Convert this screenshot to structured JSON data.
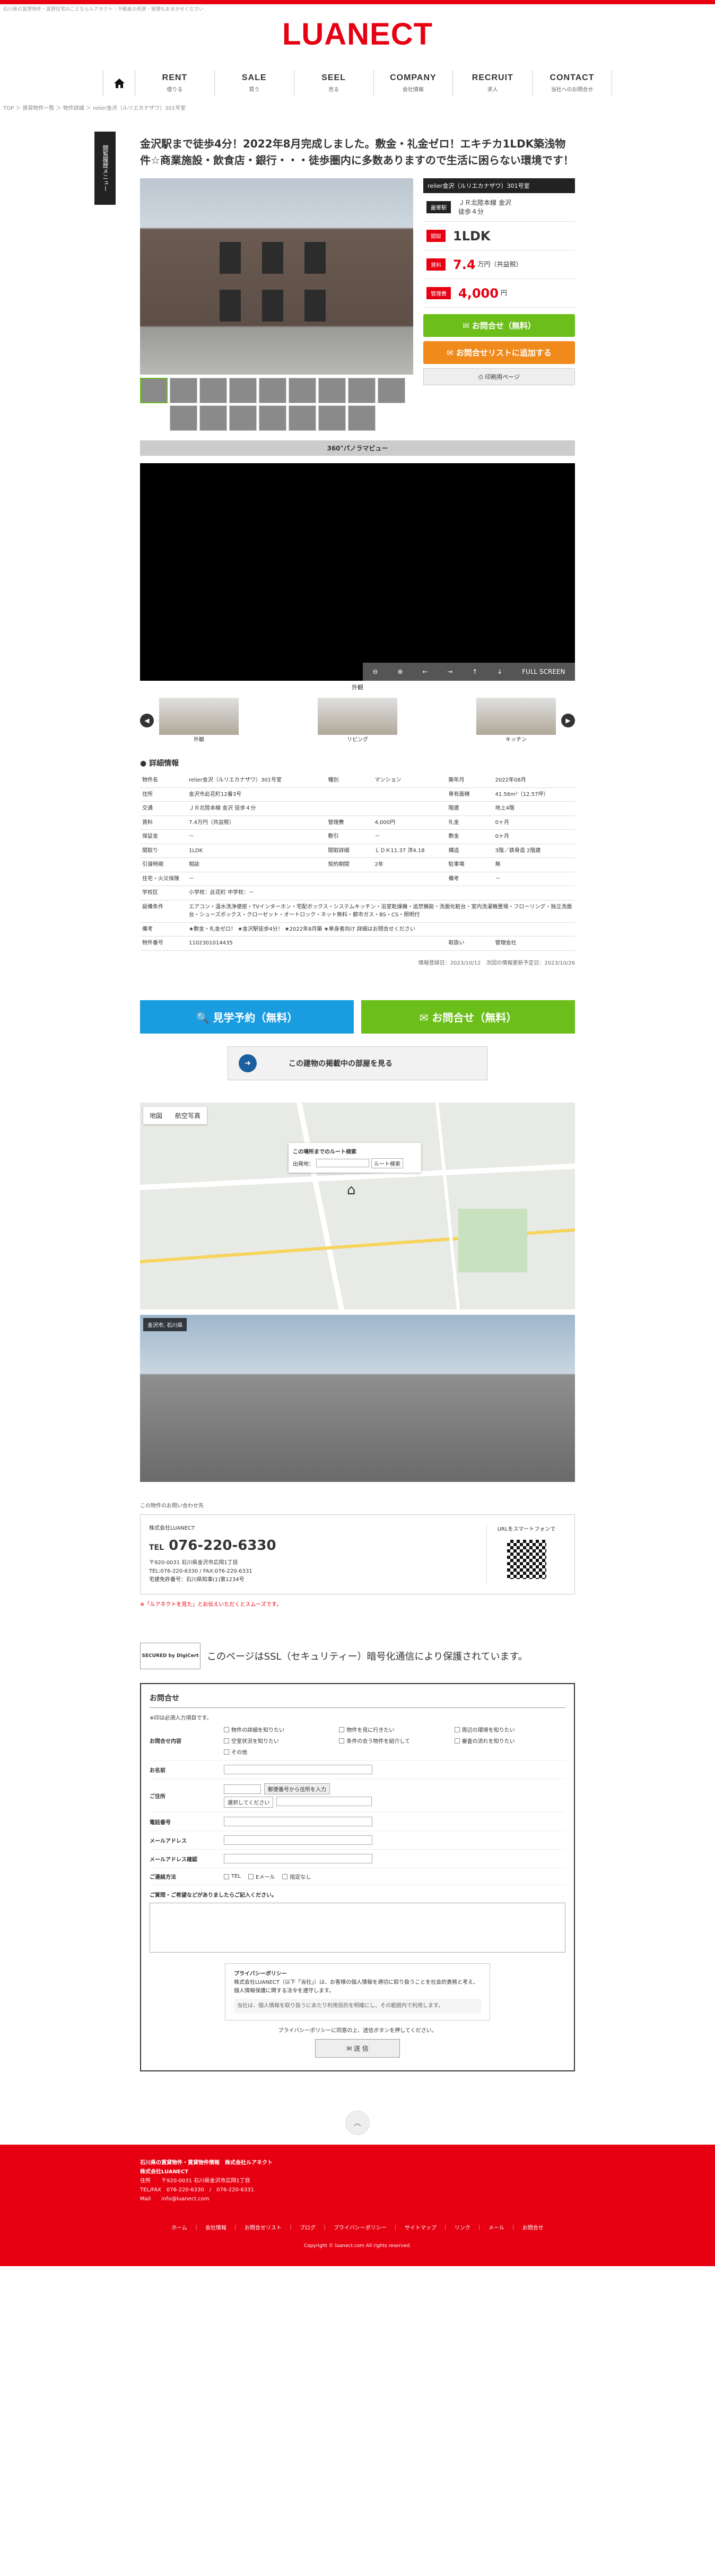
{
  "header": {
    "tagline": "石川県の賃貸物件・賃貸住宅のことならルアネクト｜不動産の売買・管理もおまかせください",
    "logo": "LUANECT",
    "nav": [
      {
        "en": "RENT",
        "ja": "借りる"
      },
      {
        "en": "SALE",
        "ja": "買う"
      },
      {
        "en": "SEEL",
        "ja": "売る"
      },
      {
        "en": "COMPANY",
        "ja": "会社情報"
      },
      {
        "en": "RECRUIT",
        "ja": "求人"
      },
      {
        "en": "CONTACT",
        "ja": "当社へのお問合せ"
      }
    ],
    "breadcrumb": "TOP ＞ 賃貸物件一覧 ＞ 物件詳細 ＞ relier金沢（ルリエカナザワ）301号室"
  },
  "side_tab": "閲覧履歴メニュー",
  "property": {
    "title": "金沢駅まで徒歩4分！2022年8月完成しました。敷金・礼金ゼロ！エキチカ1LDK築浅物件☆商業施設・飲食店・銀行・・・徒歩圏内に多数ありますので生活に困らない環境です！",
    "info_head": "relier金沢（ルリエカナザワ）301号室",
    "station_label": "最寄駅",
    "station_value": "ＪＲ北陸本線 金沢\n徒歩４分",
    "layout_label": "間取",
    "layout_value": "1LDK",
    "rent_label": "賃料",
    "rent_value": "7.4",
    "rent_unit": "万円（共益税）",
    "fee_label": "管理費",
    "fee_value": "4,000",
    "fee_unit": "円",
    "btn_contact": "お問合せ（無料）",
    "btn_list": "お問合せリストに追加する",
    "btn_print": "印刷用ページ"
  },
  "pano": {
    "title": "360°パノラマビュー",
    "caption": "外観",
    "ctrl_full": "FULL SCREEN",
    "strip": [
      "外観",
      "リビング",
      "キッチン"
    ]
  },
  "detail": {
    "heading": "詳細情報",
    "rows": [
      [
        "物件名",
        "relier金沢（ルリエカナザワ）301号室",
        "種別",
        "マンション",
        "築年月",
        "2022年08月"
      ],
      [
        "住所",
        "金沢市此花町12番3号",
        "",
        "",
        "専有面積",
        "41.56m²（12.57坪）"
      ],
      [
        "交通",
        "ＪＲ北陸本線 金沢 徒歩４分",
        "",
        "",
        "階建",
        "地上4階"
      ],
      [
        "賃料",
        "7.4万円（共益税）",
        "管理費",
        "4,000円",
        "礼金",
        "0ヶ月"
      ],
      [
        "保証金",
        "－",
        "敷引",
        "－",
        "敷金",
        "0ヶ月"
      ],
      [
        "間取り",
        "1LDK",
        "間取詳細",
        "ＬＤＫ11.37 洋4.18",
        "構造",
        "3階／鉄骨造 2階建"
      ],
      [
        "引渡時期",
        "相談",
        "契約期間",
        "2年",
        "駐車場",
        "無"
      ],
      [
        "住宅・火災保険",
        "－",
        "",
        "",
        "備考",
        "－"
      ],
      [
        "学校区",
        "小学校：此花町 中学校：－",
        "",
        "",
        "",
        ""
      ],
      [
        "設備条件",
        "エアコン・温水洗浄便座・TVインターホン・宅配ボックス・システムキッチン・浴室乾燥機・追焚機能・洗面化粧台・室内洗濯機置場・フローリング・独立洗面台・シューズボックス・クローゼット・オートロック・ネット無料・都市ガス・BS・CS・照明付",
        "",
        "",
        "",
        ""
      ],
      [
        "備考",
        "★敷金・礼金ゼロ！ ★金沢駅徒歩4分！ ★2022年8月築 ★単身者向け 詳細はお問合せください",
        "",
        "",
        "",
        ""
      ],
      [
        "物件番号",
        "1102301014435",
        "",
        "",
        "取扱い",
        "管理会社"
      ]
    ],
    "updated": "情報登録日：2023/10/12　次回の情報更新予定日：2023/10/26"
  },
  "cta": {
    "visit": "見学予約（無料）",
    "contact": "お問合せ（無料）",
    "building": "この建物の掲載中の部屋を見る"
  },
  "map": {
    "tab_map": "地図",
    "tab_sat": "航空写真",
    "route_title": "この場所までのルート検索",
    "route_from": "出発地：",
    "route_btn": "ルート検索",
    "sv_label": "金沢市, 石川県"
  },
  "contact_card": {
    "lead": "この物件のお問い合わせ先",
    "company": "株式会社LUANECT",
    "tel_prefix": "TEL",
    "tel": "076-220-6330",
    "address": "〒920-0031 石川県金沢市広岡1丁目",
    "telfax": "TEL:076-220-6330 / FAX:076-220-6331",
    "license": "宅建免許番号：石川県知事(1)第1234号",
    "qr_label": "URLをスマートフォンで"
  },
  "warning": "※「ルアネクトを見た」とお伝えいただくとスムーズです。",
  "ssl_text": "このページはSSL（セキュリティー）暗号化通信により保護されています。",
  "ssl_seal": "SECURED by DigiCert",
  "form": {
    "title": "お問合せ",
    "required_note": "※印は必須入力項目です。",
    "contents_label": "お問合せ内容",
    "checks": [
      "物件の詳細を知りたい",
      "物件を見に行きたい",
      "周辺の環境を知りたい",
      "空室状況を知りたい",
      "条件の合う物件を紹介して",
      "審査の流れを知りたい",
      "その他"
    ],
    "name_label": "お名前",
    "address_label": "ご住所",
    "zip_btn": "郵便番号から住所を入力",
    "pref_select": "選択してください",
    "tel_label": "電話番号",
    "mail_label": "メールアドレス",
    "mail2_label": "メールアドレス確認",
    "method_label": "ご連絡方法",
    "method_opts": [
      "TEL",
      "Eメール",
      "指定なし"
    ],
    "question": "ご質問・ご希望などがありましたらご記入ください。",
    "privacy_title": "プライバシーポリシー",
    "privacy_text": "株式会社LUANECT（以下「当社」）は、お客様の個人情報を適切に取り扱うことを社会的責務と考え、個人情報保護に関する法令を遵守します。",
    "privacy_inner": "当社は、個人情報を取り扱うにあたり利用目的を明確にし、その範囲内で利用します。",
    "agree": "プライバシーポリシーに同意の上、送信ボタンを押してください。",
    "submit": "送 信"
  },
  "footer": {
    "l1": "石川県の賃貸物件・賃貸物件情報　株式会社ルアネクト",
    "l2": "株式会社LUANECT",
    "l3": "住所　　〒920-0031 石川県金沢市広岡1丁目",
    "l4": "TEL/FAX　076-220-6330　/　076-220-6331",
    "l5": "Mail　　info@luanect.com",
    "nav": [
      "ホーム",
      "会社情報",
      "お問合せリスト",
      "ブログ",
      "プライバシーポリシー",
      "サイトマップ",
      "リンク",
      "メール",
      "お問合せ"
    ],
    "copy": "Copyright © luanect.com All rights reserved."
  }
}
